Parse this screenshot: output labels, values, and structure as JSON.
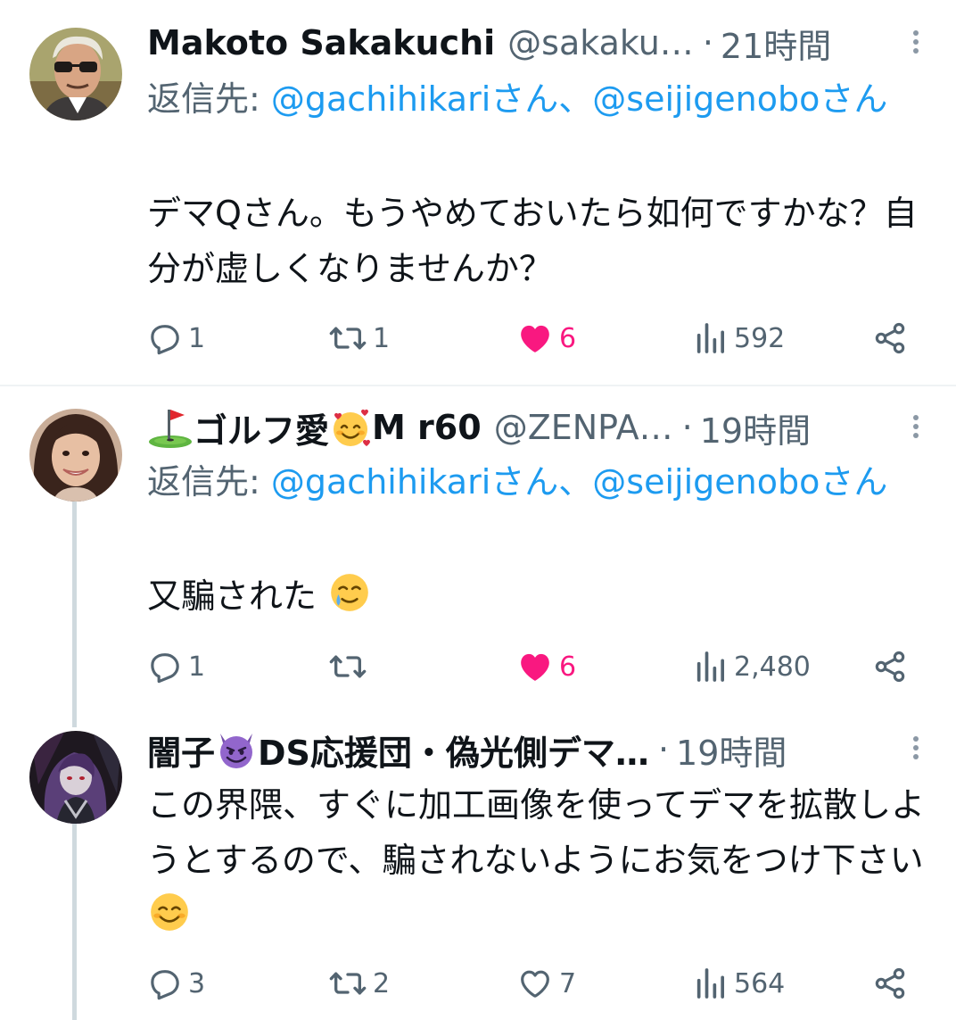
{
  "tweets": [
    {
      "name": "Makoto Sakakuchi",
      "handle": "@sakaku…",
      "dot": "·",
      "time": "21時間",
      "reply_prefix": "返信先: ",
      "mention1": "@gachihikariさん",
      "separator": "、",
      "mention2": "@seijigenoboさん",
      "text": "デマQさん。もうやめておいたら如何ですかな？自分が虚しくなりませんか？",
      "replies": "1",
      "retweets": "1",
      "likes": "6",
      "liked": true,
      "views": "592",
      "avatar_icon": "avatar-man-sunglasses"
    },
    {
      "name": "ゴルフ愛",
      "name_suffix": "M r60",
      "name_emoji_before": "golf-flag-icon",
      "name_emoji_after": "smiling-face-with-hearts-icon",
      "handle": "@ZENPA…",
      "dot": "·",
      "time": "19時間",
      "reply_prefix": "返信先: ",
      "mention1": "@gachihikariさん",
      "separator": "、",
      "mention2": "@seijigenoboさん",
      "text": "又騙された",
      "text_emoji": "smiling-face-with-tear-icon",
      "replies": "1",
      "retweets": "",
      "likes": "6",
      "liked": true,
      "views": "2,480",
      "avatar_icon": "avatar-woman-smiling"
    },
    {
      "name_prefix": "闇子",
      "name_emoji": "smiling-devil-icon",
      "name": "DS応援団・偽光側デマ…",
      "dot": "·",
      "time": "19時間",
      "text": "この界隈、すぐに加工画像を使ってデマを拡散しようとするので、騙されないようにお気をつけ下さい",
      "text_emoji": "smiling-face-icon",
      "replies": "3",
      "retweets": "2",
      "likes": "7",
      "liked": false,
      "views": "564",
      "avatar_icon": "avatar-anime-dark"
    }
  ],
  "colors": {
    "accent": "#1d9bf0",
    "like": "#f91880",
    "secondary_text": "#536471",
    "thread_line": "#cfd9de"
  }
}
